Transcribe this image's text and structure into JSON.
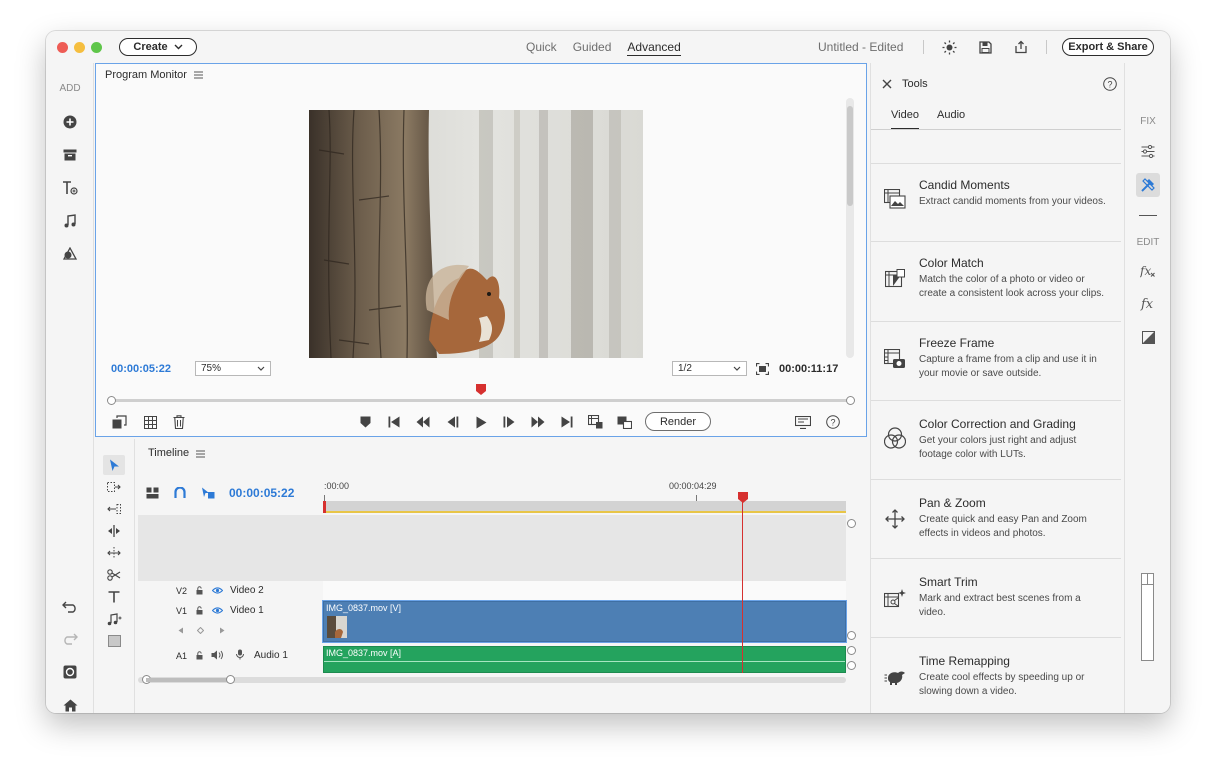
{
  "titlebar": {
    "create_label": "Create",
    "modes": [
      "Quick",
      "Guided",
      "Advanced"
    ],
    "active_mode": "Advanced",
    "doc_title": "Untitled - Edited",
    "export_label": "Export & Share",
    "traffic_lights": {
      "close": "#ee5c55",
      "minimize": "#f5be3f",
      "maximize": "#5fc64a"
    }
  },
  "left_rail": {
    "label": "ADD",
    "icons": [
      "add-media-icon",
      "archive-icon",
      "title-text-icon",
      "audio-note-icon",
      "graphics-icon"
    ],
    "bottom_icons": [
      "undo-icon",
      "redo-icon",
      "organizer-icon",
      "home-icon"
    ]
  },
  "monitor": {
    "title": "Program Monitor",
    "current_time": "00:00:05:22",
    "zoom": "75%",
    "resolution": "1/2",
    "duration": "00:00:11:17",
    "render_label": "Render",
    "playhead_fraction": 0.5
  },
  "timeline": {
    "title": "Timeline",
    "current_time": "00:00:05:22",
    "ruler_start": ":00:00",
    "ruler_mid": "00:00:04:29",
    "tracks": {
      "v2": {
        "id": "V2",
        "name": "Video 2"
      },
      "v1": {
        "id": "V1",
        "name": "Video 1",
        "clip": "IMG_0837.mov [V]"
      },
      "a1": {
        "id": "A1",
        "name": "Audio 1",
        "clip": "IMG_0837.mov [A]"
      }
    }
  },
  "tools_panel": {
    "title": "Tools",
    "tabs": [
      "Video",
      "Audio"
    ],
    "active_tab": "Video",
    "items": [
      {
        "name": "Candid Moments",
        "desc": "Extract candid moments from your videos.",
        "icon": "candid-moments-icon"
      },
      {
        "name": "Color Match",
        "desc": "Match the color of a photo or video or create a consistent look across your clips.",
        "icon": "color-match-icon"
      },
      {
        "name": "Freeze Frame",
        "desc": "Capture a frame from a clip and use it in your movie or save outside.",
        "icon": "freeze-frame-icon"
      },
      {
        "name": "Color Correction and Grading",
        "desc": "Get your colors just right and adjust footage color with LUTs.",
        "icon": "color-correction-icon"
      },
      {
        "name": "Pan & Zoom",
        "desc": "Create quick and easy Pan and Zoom effects in videos and photos.",
        "icon": "pan-zoom-icon"
      },
      {
        "name": "Smart Trim",
        "desc": "Mark and extract best scenes from a video.",
        "icon": "smart-trim-icon"
      },
      {
        "name": "Time Remapping",
        "desc": "Create cool effects by speeding up or slowing down a video.",
        "icon": "time-remapping-icon"
      }
    ]
  },
  "right_rail": {
    "fix_label": "FIX",
    "edit_label": "EDIT"
  },
  "colors": {
    "accent": "#2d7ad6",
    "playhead": "#d6302f",
    "video_clip": "#4d7fb4",
    "audio_clip": "#24a35e"
  }
}
